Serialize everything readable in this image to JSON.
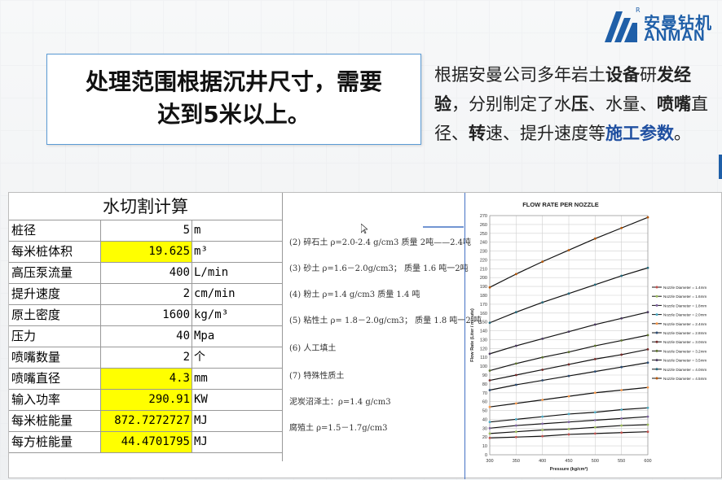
{
  "logo": {
    "cn": "安曼钻机",
    "en": "ANMAN",
    "reg": "R"
  },
  "left_box": {
    "line1": "处理范围根据沉井尺寸，需要",
    "line2": "达到5米以上。"
  },
  "right_box": {
    "seg1": "根据安曼公司多年岩土",
    "seg2": "设备",
    "seg3": "研",
    "seg4": "发经验",
    "seg5": "，分别制定了水",
    "seg6": "压",
    "seg7": "、水量、",
    "seg8": "喷嘴",
    "seg9": "直径、",
    "seg10": "转",
    "seg11": "速、提升速度等",
    "seg12": "施工参数",
    "seg13": "。"
  },
  "calc": {
    "title": "水切割计算",
    "rows": [
      {
        "label": "桩径",
        "value": "5",
        "unit": "m",
        "highlight": false
      },
      {
        "label": "每米桩体积",
        "value": "19.625",
        "unit": "m³",
        "highlight": true
      },
      {
        "label": "高压泵流量",
        "value": "400",
        "unit": "L/min",
        "highlight": false
      },
      {
        "label": "提升速度",
        "value": "2",
        "unit": "cm/min",
        "highlight": false
      },
      {
        "label": "原土密度",
        "value": "1600",
        "unit": "kg/m³",
        "highlight": false
      },
      {
        "label": "压力",
        "value": "40",
        "unit": "Mpa",
        "highlight": false
      },
      {
        "label": "喷嘴数量",
        "value": "2",
        "unit": "个",
        "highlight": false
      },
      {
        "label": "喷嘴直径",
        "value": "4.3",
        "unit": "mm",
        "highlight": true
      },
      {
        "label": "输入功率",
        "value": "290.91",
        "unit": "KW",
        "highlight": true
      },
      {
        "label": "每米桩能量",
        "value": "872.7272727",
        "unit": "MJ",
        "highlight": true
      },
      {
        "label": "每方桩能量",
        "value": "44.4701795",
        "unit": "MJ",
        "highlight": true
      }
    ]
  },
  "soil": [
    "(2) 碎石土   ρ=2.0-2.4 g/cm3        质量 2吨——2.4吨",
    "(3) 砂土    ρ=1.6－2.0g/cm3；   质量 1.6 吨一2吨",
    "(4) 粉土    ρ=1.4 g/cm3            质量 1.4 吨",
    "(5) 粘性土   ρ= 1.8－2.0g/cm3；   质量 1.8 吨一2 吨",
    "(6) 人工填土",
    "(7) 特殊性质土",
    "泥炭沼泽土：ρ=1.4 g/cm3",
    "腐殖土 ρ=1.5－1.7g/cm3"
  ],
  "chart_data": {
    "type": "line",
    "title": "FLOW RATE PER NOZZLE",
    "xlabel": "Pressure (kg/cm²)",
    "ylabel": "Flow Rate (Liter / minute)",
    "xlim": [
      300,
      600
    ],
    "ylim": [
      0,
      270
    ],
    "x": [
      300,
      350,
      400,
      450,
      500,
      550,
      600
    ],
    "xticks": [
      300,
      350,
      400,
      450,
      500,
      550,
      600
    ],
    "yticks": [
      0,
      10,
      20,
      30,
      40,
      50,
      60,
      70,
      80,
      90,
      100,
      110,
      120,
      130,
      140,
      150,
      160,
      170,
      180,
      190,
      200,
      210,
      220,
      230,
      240,
      250,
      260,
      270
    ],
    "grid": true,
    "legend": "right",
    "series": [
      {
        "name": "Nozzle Diameter = 1.4mm",
        "color": "#c0504d",
        "values": [
          19,
          20,
          21,
          23,
          24,
          25,
          26
        ]
      },
      {
        "name": "Nozzle Diameter = 1.6mm",
        "color": "#9bbb59",
        "values": [
          24,
          26,
          28,
          29,
          31,
          33,
          34
        ]
      },
      {
        "name": "Nozzle Diameter = 1.8mm",
        "color": "#8064a2",
        "values": [
          30,
          33,
          35,
          37,
          39,
          41,
          43
        ]
      },
      {
        "name": "Nozzle Diameter = 2.0mm",
        "color": "#4bacc6",
        "values": [
          37,
          40,
          43,
          46,
          48,
          51,
          53
        ]
      },
      {
        "name": "Nozzle Diameter = 2.4mm",
        "color": "#f79646",
        "values": [
          54,
          58,
          62,
          66,
          70,
          73,
          76
        ]
      },
      {
        "name": "Nozzle Diameter = 2.8mm",
        "color": "#2c4d75",
        "values": [
          73,
          79,
          84,
          89,
          94,
          99,
          104
        ]
      },
      {
        "name": "Nozzle Diameter = 3.0mm",
        "color": "#772c2a",
        "values": [
          84,
          90,
          96,
          102,
          108,
          113,
          119
        ]
      },
      {
        "name": "Nozzle Diameter = 3.2mm",
        "color": "#5f7530",
        "values": [
          95,
          103,
          110,
          116,
          123,
          129,
          135
        ]
      },
      {
        "name": "Nozzle Diameter = 3.5mm",
        "color": "#4d3b62",
        "values": [
          114,
          123,
          131,
          139,
          147,
          154,
          161
        ]
      },
      {
        "name": "Nozzle Diameter = 4.0mm",
        "color": "#276a7c",
        "values": [
          149,
          161,
          172,
          182,
          192,
          202,
          211
        ]
      },
      {
        "name": "Nozzle Diameter = 4.5mm",
        "color": "#b65708",
        "values": [
          189,
          204,
          218,
          231,
          244,
          256,
          268
        ]
      }
    ]
  }
}
